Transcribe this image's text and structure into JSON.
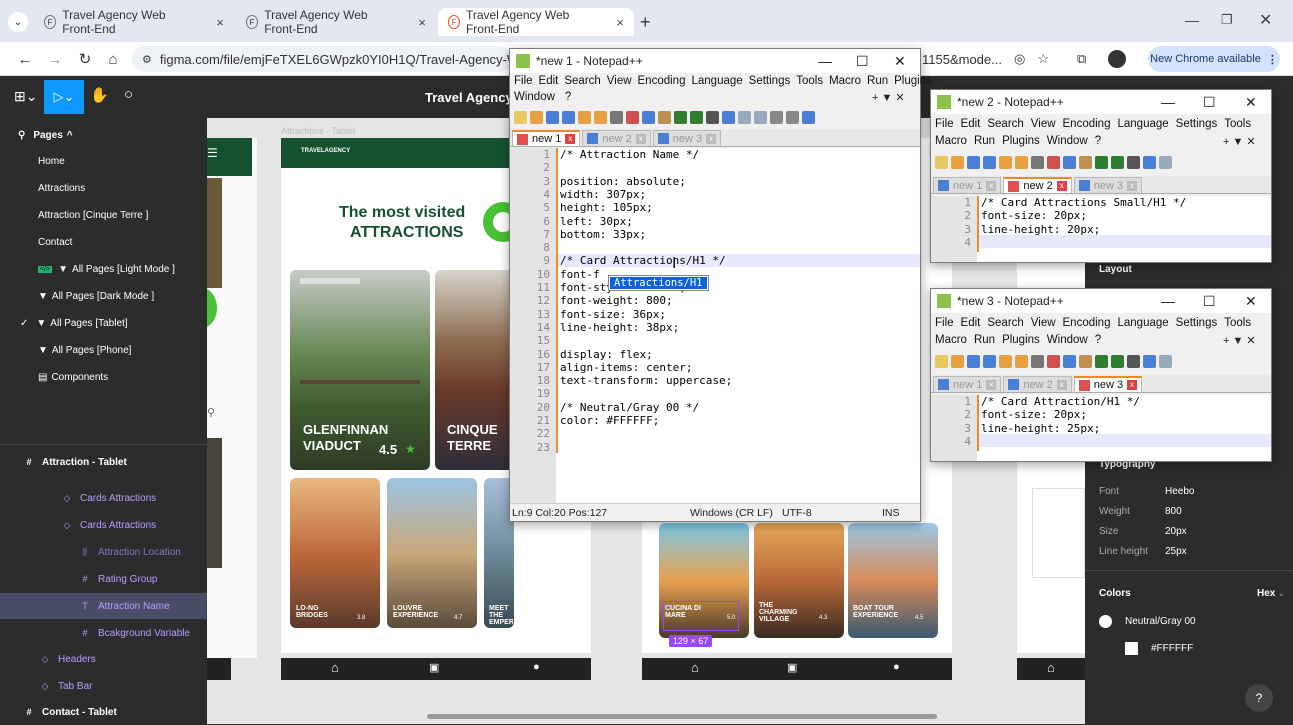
{
  "browser": {
    "tabs": [
      {
        "title": "Travel Agency Web Front-End"
      },
      {
        "title": "Travel Agency Web Front-End"
      },
      {
        "title": "Travel Agency Web Front-End"
      }
    ],
    "url": "figma.com/file/emjFeTXEL6GWpzk0YI0H1Q/Travel-Agency-Web-Fr",
    "url_tail": "1155&mode...",
    "new_chrome": "New Chrome available"
  },
  "figma": {
    "file_title": "Travel Agency",
    "pages_header": "Pages",
    "pages": [
      {
        "label": "Home"
      },
      {
        "label": "Attractions"
      },
      {
        "label": "Attraction [Cinque Terre ]"
      },
      {
        "label": "Contact"
      },
      {
        "label": "All Pages [Light Mode ]"
      },
      {
        "label": "All Pages [Dark Mode ]"
      },
      {
        "label": "All Pages [Tablet]"
      },
      {
        "label": "All Pages [Phone]"
      },
      {
        "label": "Components"
      }
    ],
    "layers": [
      {
        "label": "Attraction - Tablet"
      },
      {
        "label": "Cards Attractions"
      },
      {
        "label": "Cards Attractions"
      },
      {
        "label": "Attraction Location"
      },
      {
        "label": "Rating Group"
      },
      {
        "label": "Attraction Name"
      },
      {
        "label": "Bcakground Variable"
      },
      {
        "label": "Headers"
      },
      {
        "label": "Tab Bar"
      },
      {
        "label": "Contact - Tablet"
      }
    ],
    "right_panel": {
      "layout": "Layout",
      "typography": "Typography",
      "font_label": "Font",
      "font_value": "Heebo",
      "weight_label": "Weight",
      "weight_value": "800",
      "size_label": "Size",
      "size_value": "20px",
      "lh_label": "Line height",
      "lh_value": "25px",
      "colors": "Colors",
      "hex": "Hex",
      "color_name": "Neutral/Gray 00",
      "color_value": "#FFFFFF"
    },
    "canvas": {
      "breadcrumb": "Attractions - Tablet",
      "logo": "TRAVELAGENCY",
      "headline1": "The most visited",
      "headline2": "ATTRACTIONS",
      "card1_name1": "GLENFINNAN",
      "card1_name2": "VIADUCT",
      "card1_rating": "4.5",
      "card2_name1": "CINQUE",
      "card2_name2": "TERRE",
      "small_cards": [
        {
          "name": "LO-NG BRIDGES",
          "rating": "3.8"
        },
        {
          "name": "LOUVRE EXPERIENCE",
          "rating": "4.7"
        },
        {
          "name": "MEET THE EMPEROR",
          "rating": ""
        },
        {
          "name": "CUCINA DI MARE",
          "rating": "5.0"
        },
        {
          "name": "THE CHARMING VILLAGE",
          "rating": "4.3"
        },
        {
          "name": "BOAT TOUR EXPERIENCE",
          "rating": "4.5"
        }
      ],
      "selection_size": "129 × 67"
    }
  },
  "npp1": {
    "title": "*new 1 - Notepad++",
    "menu1": [
      "File",
      "Edit",
      "Search",
      "View",
      "Encoding",
      "Language",
      "Settings",
      "Tools",
      "Macro",
      "Run",
      "Plugins"
    ],
    "menu2": [
      "Window",
      "?"
    ],
    "tabs": [
      "new 1",
      "new 2",
      "new 3"
    ],
    "lines": [
      "/* Attraction Name */",
      "",
      "position: absolute;",
      "width: 307px;",
      "height: 105px;",
      "left: 30px;",
      "bottom: 33px;",
      "",
      "/* Card Attractions/H1 */",
      "font-f",
      "font-style: normal;",
      "font-weight: 800;",
      "font-size: 36px;",
      "line-height: 38px;",
      "",
      "display: flex;",
      "align-items: center;",
      "text-transform: uppercase;",
      "",
      "/* Neutral/Gray 00 */",
      "color: #FFFFFF;",
      "",
      ""
    ],
    "autocomplete": "Attractions/H1",
    "status_pos": "Ln:9   Col:20   Pos:127",
    "status_eol": "Windows (CR LF)",
    "status_enc": "UTF-8",
    "status_mode": "INS"
  },
  "npp2": {
    "title": "*new 2 - Notepad++",
    "menu1": [
      "File",
      "Edit",
      "Search",
      "View",
      "Encoding",
      "Language",
      "Settings",
      "Tools"
    ],
    "menu2": [
      "Macro",
      "Run",
      "Plugins",
      "Window",
      "?"
    ],
    "tabs": [
      "new 1",
      "new 2",
      "new 3"
    ],
    "lines": [
      "/* Card Attractions Small/H1 */",
      "font-size: 20px;",
      "line-height: 20px;",
      ""
    ]
  },
  "npp3": {
    "title": "*new 3 - Notepad++",
    "menu1": [
      "File",
      "Edit",
      "Search",
      "View",
      "Encoding",
      "Language",
      "Settings",
      "Tools"
    ],
    "menu2": [
      "Macro",
      "Run",
      "Plugins",
      "Window",
      "?"
    ],
    "tabs": [
      "new 1",
      "new 2",
      "new 3"
    ],
    "lines": [
      "/* Card Attraction/H1 */",
      "font-size: 20px;",
      "line-height: 25px;",
      ""
    ]
  }
}
